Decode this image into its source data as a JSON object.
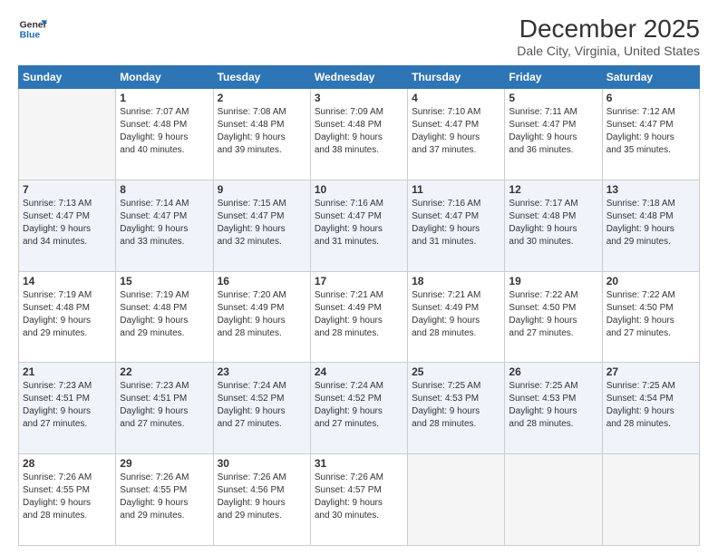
{
  "header": {
    "logo_line1": "General",
    "logo_line2": "Blue",
    "month_title": "December 2025",
    "subtitle": "Dale City, Virginia, United States"
  },
  "days_of_week": [
    "Sunday",
    "Monday",
    "Tuesday",
    "Wednesday",
    "Thursday",
    "Friday",
    "Saturday"
  ],
  "weeks": [
    [
      {
        "day": "",
        "info": ""
      },
      {
        "day": "1",
        "info": "Sunrise: 7:07 AM\nSunset: 4:48 PM\nDaylight: 9 hours\nand 40 minutes."
      },
      {
        "day": "2",
        "info": "Sunrise: 7:08 AM\nSunset: 4:48 PM\nDaylight: 9 hours\nand 39 minutes."
      },
      {
        "day": "3",
        "info": "Sunrise: 7:09 AM\nSunset: 4:48 PM\nDaylight: 9 hours\nand 38 minutes."
      },
      {
        "day": "4",
        "info": "Sunrise: 7:10 AM\nSunset: 4:47 PM\nDaylight: 9 hours\nand 37 minutes."
      },
      {
        "day": "5",
        "info": "Sunrise: 7:11 AM\nSunset: 4:47 PM\nDaylight: 9 hours\nand 36 minutes."
      },
      {
        "day": "6",
        "info": "Sunrise: 7:12 AM\nSunset: 4:47 PM\nDaylight: 9 hours\nand 35 minutes."
      }
    ],
    [
      {
        "day": "7",
        "info": "Sunrise: 7:13 AM\nSunset: 4:47 PM\nDaylight: 9 hours\nand 34 minutes."
      },
      {
        "day": "8",
        "info": "Sunrise: 7:14 AM\nSunset: 4:47 PM\nDaylight: 9 hours\nand 33 minutes."
      },
      {
        "day": "9",
        "info": "Sunrise: 7:15 AM\nSunset: 4:47 PM\nDaylight: 9 hours\nand 32 minutes."
      },
      {
        "day": "10",
        "info": "Sunrise: 7:16 AM\nSunset: 4:47 PM\nDaylight: 9 hours\nand 31 minutes."
      },
      {
        "day": "11",
        "info": "Sunrise: 7:16 AM\nSunset: 4:47 PM\nDaylight: 9 hours\nand 31 minutes."
      },
      {
        "day": "12",
        "info": "Sunrise: 7:17 AM\nSunset: 4:48 PM\nDaylight: 9 hours\nand 30 minutes."
      },
      {
        "day": "13",
        "info": "Sunrise: 7:18 AM\nSunset: 4:48 PM\nDaylight: 9 hours\nand 29 minutes."
      }
    ],
    [
      {
        "day": "14",
        "info": "Sunrise: 7:19 AM\nSunset: 4:48 PM\nDaylight: 9 hours\nand 29 minutes."
      },
      {
        "day": "15",
        "info": "Sunrise: 7:19 AM\nSunset: 4:48 PM\nDaylight: 9 hours\nand 29 minutes."
      },
      {
        "day": "16",
        "info": "Sunrise: 7:20 AM\nSunset: 4:49 PM\nDaylight: 9 hours\nand 28 minutes."
      },
      {
        "day": "17",
        "info": "Sunrise: 7:21 AM\nSunset: 4:49 PM\nDaylight: 9 hours\nand 28 minutes."
      },
      {
        "day": "18",
        "info": "Sunrise: 7:21 AM\nSunset: 4:49 PM\nDaylight: 9 hours\nand 28 minutes."
      },
      {
        "day": "19",
        "info": "Sunrise: 7:22 AM\nSunset: 4:50 PM\nDaylight: 9 hours\nand 27 minutes."
      },
      {
        "day": "20",
        "info": "Sunrise: 7:22 AM\nSunset: 4:50 PM\nDaylight: 9 hours\nand 27 minutes."
      }
    ],
    [
      {
        "day": "21",
        "info": "Sunrise: 7:23 AM\nSunset: 4:51 PM\nDaylight: 9 hours\nand 27 minutes."
      },
      {
        "day": "22",
        "info": "Sunrise: 7:23 AM\nSunset: 4:51 PM\nDaylight: 9 hours\nand 27 minutes."
      },
      {
        "day": "23",
        "info": "Sunrise: 7:24 AM\nSunset: 4:52 PM\nDaylight: 9 hours\nand 27 minutes."
      },
      {
        "day": "24",
        "info": "Sunrise: 7:24 AM\nSunset: 4:52 PM\nDaylight: 9 hours\nand 27 minutes."
      },
      {
        "day": "25",
        "info": "Sunrise: 7:25 AM\nSunset: 4:53 PM\nDaylight: 9 hours\nand 28 minutes."
      },
      {
        "day": "26",
        "info": "Sunrise: 7:25 AM\nSunset: 4:53 PM\nDaylight: 9 hours\nand 28 minutes."
      },
      {
        "day": "27",
        "info": "Sunrise: 7:25 AM\nSunset: 4:54 PM\nDaylight: 9 hours\nand 28 minutes."
      }
    ],
    [
      {
        "day": "28",
        "info": "Sunrise: 7:26 AM\nSunset: 4:55 PM\nDaylight: 9 hours\nand 28 minutes."
      },
      {
        "day": "29",
        "info": "Sunrise: 7:26 AM\nSunset: 4:55 PM\nDaylight: 9 hours\nand 29 minutes."
      },
      {
        "day": "30",
        "info": "Sunrise: 7:26 AM\nSunset: 4:56 PM\nDaylight: 9 hours\nand 29 minutes."
      },
      {
        "day": "31",
        "info": "Sunrise: 7:26 AM\nSunset: 4:57 PM\nDaylight: 9 hours\nand 30 minutes."
      },
      {
        "day": "",
        "info": ""
      },
      {
        "day": "",
        "info": ""
      },
      {
        "day": "",
        "info": ""
      }
    ]
  ]
}
